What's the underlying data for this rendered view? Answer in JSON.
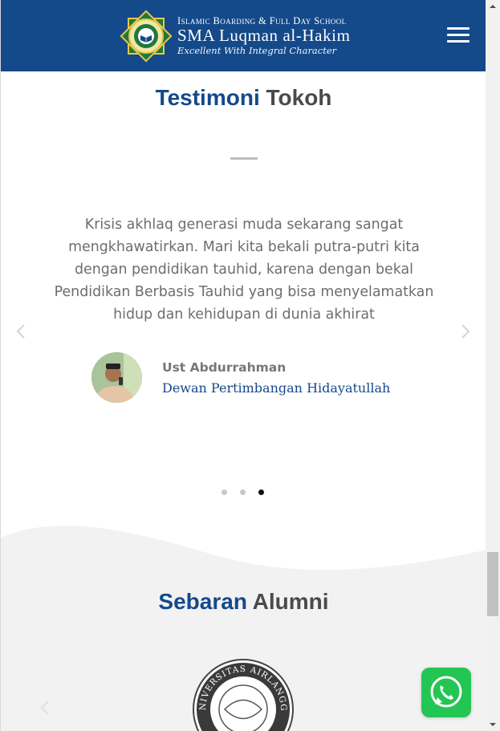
{
  "header": {
    "logo_top": "Islamic Boarding & Full Day School",
    "logo_main": "SMA Luqman al-Hakim",
    "logo_tagline": "Excellent With Integral Character",
    "brand_color": "#14498a",
    "menu_icon": "hamburger-menu-icon"
  },
  "testimoni": {
    "title_part1": "Testimoni",
    "title_part2": "Tokoh",
    "quote": "Krisis akhlaq generasi muda sekarang sangat mengkhawatirkan. Mari kita bekali putra-putri kita dengan pendidikan tauhid, karena dengan bekal Pendidikan Berbasis Tauhid yang bisa menyelamatkan hidup dan kehidupan di dunia akhirat",
    "person_name": "Ust Abdurrahman",
    "person_role": "Dewan Pertimbangan Hidayatullah",
    "slide_count": 3,
    "active_slide": 3,
    "prev_icon": "chevron-left-icon",
    "next_icon": "chevron-right-icon"
  },
  "alumni": {
    "title_part1": "Sebaran",
    "title_part2": "Alumni",
    "logo_text": "UNIVERSITAS AIRLANGGA"
  },
  "whatsapp": {
    "icon": "whatsapp-icon",
    "color": "#23c653"
  }
}
